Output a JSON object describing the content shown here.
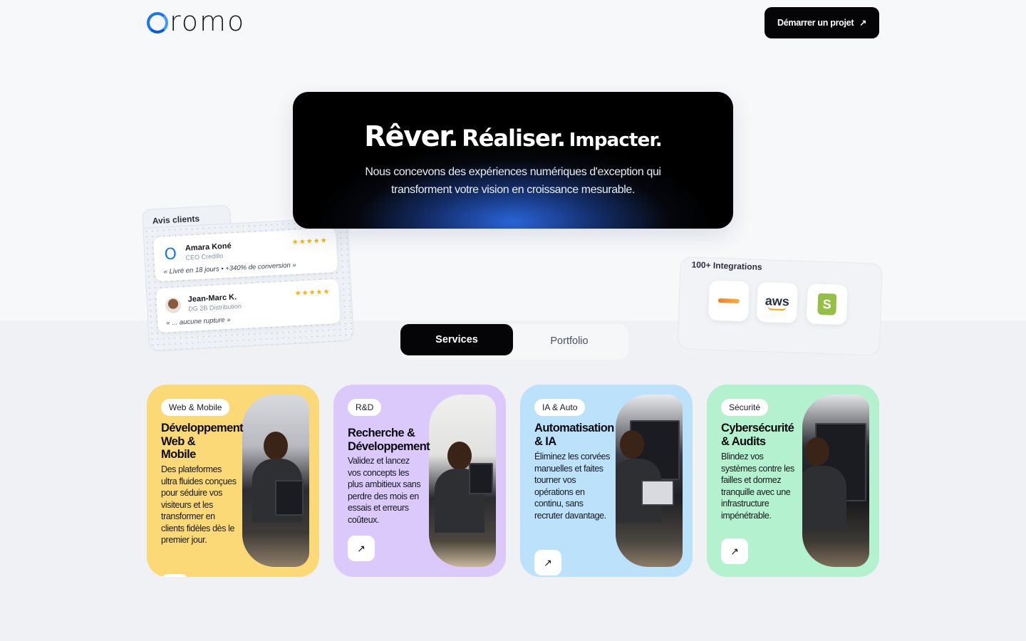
{
  "header": {
    "logo_text": "romo",
    "logo_alt": "Oromo",
    "cta_label": "Démarrer un projet",
    "cta_icon": "arrow-up-right-icon"
  },
  "hero": {
    "title_1": "Rêver.",
    "title_2": "Réaliser.",
    "title_3": "Impacter.",
    "subtitle": "Nous concevons des expériences numériques d'exception qui transforment votre vision en croissance mesurable."
  },
  "reviews": {
    "title": "Avis clients",
    "items": [
      {
        "name": "Amara Koné",
        "role": "CEO Credillo",
        "stars": "★★★★★",
        "quote": "« Livré en 18 jours • +340% de conversion »",
        "avatar": "O"
      },
      {
        "name": "Jean-Marc K.",
        "role": "DG 2B Distribution",
        "stars": "★★★★★",
        "quote": "« ... aucune rupture »",
        "avatar": ""
      }
    ]
  },
  "integrations": {
    "title": "100+ Integrations",
    "logos": [
      "cloudflare-logo",
      "aws-logo",
      "shopify-logo"
    ],
    "aws_text": "aws",
    "shopify_letter": "S"
  },
  "tabs": {
    "active": "Services",
    "inactive": "Portfolio"
  },
  "services": [
    {
      "badge": "Web & Mobile",
      "title": "Développement\nWeb &\nMobile",
      "desc": "Des plateformes ultra fluides conçues pour séduire vos visiteurs et les transformer en clients fidèles dès le premier jour.",
      "color": "#fcd977"
    },
    {
      "badge": "R&D",
      "title": "Recherche &\nDéveloppement",
      "desc": "Validez et lancez vos concepts les plus ambitieux sans perdre des mois en essais et erreurs coûteux.",
      "color": "#dcc9fb"
    },
    {
      "badge": "IA & Auto",
      "title": "Automatisation\n& IA",
      "desc": "Éliminez les corvées manuelles et faites tourner vos opérations en continu, sans recruter davantage.",
      "color": "#bce2fb"
    },
    {
      "badge": "Sécurité",
      "title": "Cybersécurité\n& Audits",
      "desc": "Blindez vos systèmes contre les failles et dormez tranquille avec une infrastructure impénétrable.",
      "color": "#b4f1cf"
    }
  ],
  "card_link_icon": "arrow-up-right-icon",
  "card_link_symbol": "↗"
}
